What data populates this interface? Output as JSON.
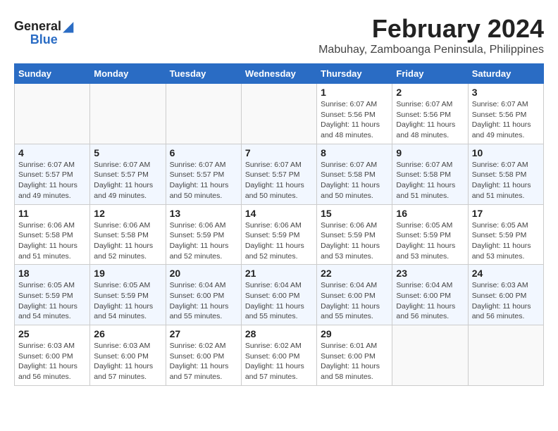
{
  "logo": {
    "general": "General",
    "blue": "Blue"
  },
  "title": "February 2024",
  "subtitle": "Mabuhay, Zamboanga Peninsula, Philippines",
  "days_of_week": [
    "Sunday",
    "Monday",
    "Tuesday",
    "Wednesday",
    "Thursday",
    "Friday",
    "Saturday"
  ],
  "weeks": [
    [
      {
        "num": "",
        "info": "",
        "empty": true
      },
      {
        "num": "",
        "info": "",
        "empty": true
      },
      {
        "num": "",
        "info": "",
        "empty": true
      },
      {
        "num": "",
        "info": "",
        "empty": true
      },
      {
        "num": "1",
        "info": "Sunrise: 6:07 AM\nSunset: 5:56 PM\nDaylight: 11 hours\nand 48 minutes.",
        "empty": false
      },
      {
        "num": "2",
        "info": "Sunrise: 6:07 AM\nSunset: 5:56 PM\nDaylight: 11 hours\nand 48 minutes.",
        "empty": false
      },
      {
        "num": "3",
        "info": "Sunrise: 6:07 AM\nSunset: 5:56 PM\nDaylight: 11 hours\nand 49 minutes.",
        "empty": false
      }
    ],
    [
      {
        "num": "4",
        "info": "Sunrise: 6:07 AM\nSunset: 5:57 PM\nDaylight: 11 hours\nand 49 minutes.",
        "empty": false
      },
      {
        "num": "5",
        "info": "Sunrise: 6:07 AM\nSunset: 5:57 PM\nDaylight: 11 hours\nand 49 minutes.",
        "empty": false
      },
      {
        "num": "6",
        "info": "Sunrise: 6:07 AM\nSunset: 5:57 PM\nDaylight: 11 hours\nand 50 minutes.",
        "empty": false
      },
      {
        "num": "7",
        "info": "Sunrise: 6:07 AM\nSunset: 5:57 PM\nDaylight: 11 hours\nand 50 minutes.",
        "empty": false
      },
      {
        "num": "8",
        "info": "Sunrise: 6:07 AM\nSunset: 5:58 PM\nDaylight: 11 hours\nand 50 minutes.",
        "empty": false
      },
      {
        "num": "9",
        "info": "Sunrise: 6:07 AM\nSunset: 5:58 PM\nDaylight: 11 hours\nand 51 minutes.",
        "empty": false
      },
      {
        "num": "10",
        "info": "Sunrise: 6:07 AM\nSunset: 5:58 PM\nDaylight: 11 hours\nand 51 minutes.",
        "empty": false
      }
    ],
    [
      {
        "num": "11",
        "info": "Sunrise: 6:06 AM\nSunset: 5:58 PM\nDaylight: 11 hours\nand 51 minutes.",
        "empty": false
      },
      {
        "num": "12",
        "info": "Sunrise: 6:06 AM\nSunset: 5:58 PM\nDaylight: 11 hours\nand 52 minutes.",
        "empty": false
      },
      {
        "num": "13",
        "info": "Sunrise: 6:06 AM\nSunset: 5:59 PM\nDaylight: 11 hours\nand 52 minutes.",
        "empty": false
      },
      {
        "num": "14",
        "info": "Sunrise: 6:06 AM\nSunset: 5:59 PM\nDaylight: 11 hours\nand 52 minutes.",
        "empty": false
      },
      {
        "num": "15",
        "info": "Sunrise: 6:06 AM\nSunset: 5:59 PM\nDaylight: 11 hours\nand 53 minutes.",
        "empty": false
      },
      {
        "num": "16",
        "info": "Sunrise: 6:05 AM\nSunset: 5:59 PM\nDaylight: 11 hours\nand 53 minutes.",
        "empty": false
      },
      {
        "num": "17",
        "info": "Sunrise: 6:05 AM\nSunset: 5:59 PM\nDaylight: 11 hours\nand 53 minutes.",
        "empty": false
      }
    ],
    [
      {
        "num": "18",
        "info": "Sunrise: 6:05 AM\nSunset: 5:59 PM\nDaylight: 11 hours\nand 54 minutes.",
        "empty": false
      },
      {
        "num": "19",
        "info": "Sunrise: 6:05 AM\nSunset: 5:59 PM\nDaylight: 11 hours\nand 54 minutes.",
        "empty": false
      },
      {
        "num": "20",
        "info": "Sunrise: 6:04 AM\nSunset: 6:00 PM\nDaylight: 11 hours\nand 55 minutes.",
        "empty": false
      },
      {
        "num": "21",
        "info": "Sunrise: 6:04 AM\nSunset: 6:00 PM\nDaylight: 11 hours\nand 55 minutes.",
        "empty": false
      },
      {
        "num": "22",
        "info": "Sunrise: 6:04 AM\nSunset: 6:00 PM\nDaylight: 11 hours\nand 55 minutes.",
        "empty": false
      },
      {
        "num": "23",
        "info": "Sunrise: 6:04 AM\nSunset: 6:00 PM\nDaylight: 11 hours\nand 56 minutes.",
        "empty": false
      },
      {
        "num": "24",
        "info": "Sunrise: 6:03 AM\nSunset: 6:00 PM\nDaylight: 11 hours\nand 56 minutes.",
        "empty": false
      }
    ],
    [
      {
        "num": "25",
        "info": "Sunrise: 6:03 AM\nSunset: 6:00 PM\nDaylight: 11 hours\nand 56 minutes.",
        "empty": false
      },
      {
        "num": "26",
        "info": "Sunrise: 6:03 AM\nSunset: 6:00 PM\nDaylight: 11 hours\nand 57 minutes.",
        "empty": false
      },
      {
        "num": "27",
        "info": "Sunrise: 6:02 AM\nSunset: 6:00 PM\nDaylight: 11 hours\nand 57 minutes.",
        "empty": false
      },
      {
        "num": "28",
        "info": "Sunrise: 6:02 AM\nSunset: 6:00 PM\nDaylight: 11 hours\nand 57 minutes.",
        "empty": false
      },
      {
        "num": "29",
        "info": "Sunrise: 6:01 AM\nSunset: 6:00 PM\nDaylight: 11 hours\nand 58 minutes.",
        "empty": false
      },
      {
        "num": "",
        "info": "",
        "empty": true
      },
      {
        "num": "",
        "info": "",
        "empty": true
      }
    ]
  ]
}
